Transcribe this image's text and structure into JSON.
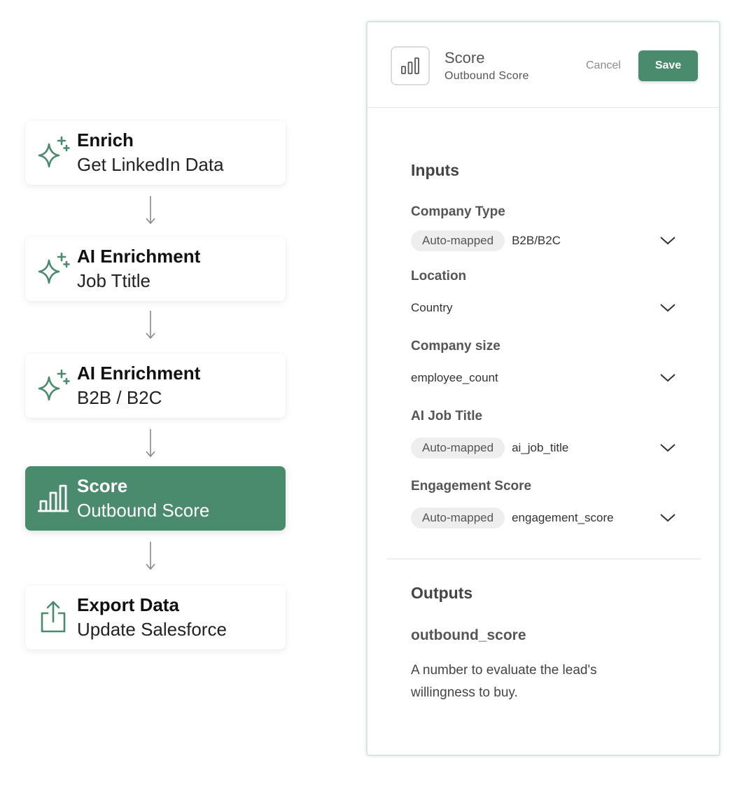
{
  "workflow": {
    "steps": [
      {
        "title": "Enrich",
        "subtitle": "Get LinkedIn Data",
        "icon": "sparkle-icon"
      },
      {
        "title": "AI Enrichment",
        "subtitle": "Job Ttitle",
        "icon": "sparkle-icon"
      },
      {
        "title": "AI Enrichment",
        "subtitle": "B2B / B2C",
        "icon": "sparkle-icon"
      },
      {
        "title": "Score",
        "subtitle": "Outbound Score",
        "icon": "bar-chart-icon",
        "active": true
      },
      {
        "title": "Export Data",
        "subtitle": "Update Salesforce",
        "icon": "upload-icon"
      }
    ]
  },
  "panel": {
    "header": {
      "title": "Score",
      "subtitle": "Outbound Score",
      "cancel_label": "Cancel",
      "save_label": "Save"
    },
    "inputs": {
      "title": "Inputs",
      "fields": [
        {
          "label": "Company Type",
          "chip": "Auto-mapped",
          "value": "B2B/B2C"
        },
        {
          "label": "Location",
          "chip": "",
          "value": "Country"
        },
        {
          "label": "Company size",
          "chip": "",
          "value": "employee_count"
        },
        {
          "label": "AI Job Title",
          "chip": "Auto-mapped",
          "value": "ai_job_title"
        },
        {
          "label": "Engagement Score",
          "chip": "Auto-mapped",
          "value": "engagement_score"
        }
      ]
    },
    "outputs": {
      "title": "Outputs",
      "name": "outbound_score",
      "description": "A number to evaluate the lead's willingness to buy."
    }
  },
  "colors": {
    "accent": "#4a8b6d",
    "chip_bg": "#eeeeee",
    "panel_border": "#d6e8dc"
  }
}
